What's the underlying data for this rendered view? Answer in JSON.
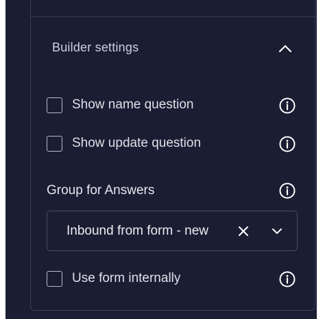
{
  "builder_settings": {
    "title": "Builder settings",
    "expanded": true,
    "options": [
      {
        "label": "Show name question",
        "checked": false
      },
      {
        "label": "Show update question",
        "checked": false
      }
    ],
    "group_for_answers": {
      "label": "Group for Answers",
      "selected_value": "Inbound from form - new"
    },
    "use_form_internally": {
      "label": "Use form internally",
      "checked": false
    }
  },
  "icons": {
    "section_toggle": "chevron-up-icon",
    "info": "info-icon",
    "clear": "close-icon",
    "dropdown": "chevron-down-icon"
  },
  "colors": {
    "panel_background": "#1b1d32",
    "border": "#3b3e56",
    "text": "#dfe0ea",
    "icon": "#ffffff"
  }
}
